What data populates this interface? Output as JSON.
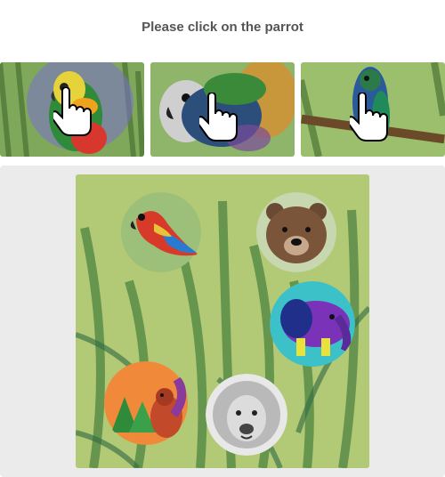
{
  "instruction": "Please click on the parrot",
  "examples": [
    {
      "subject": "parrot",
      "icon": "hand-pointer-icon"
    },
    {
      "subject": "parrot",
      "icon": "hand-pointer-icon"
    },
    {
      "subject": "parrot",
      "icon": "hand-pointer-icon"
    }
  ],
  "challenge": {
    "background": "bamboo-watercolor",
    "animals": [
      "parrot",
      "bear",
      "elephant",
      "squirrel",
      "lion"
    ]
  },
  "colors": {
    "panel_bg": "#ebebeb",
    "scene_green": "#a9c46a",
    "instruction_text": "#555555"
  }
}
